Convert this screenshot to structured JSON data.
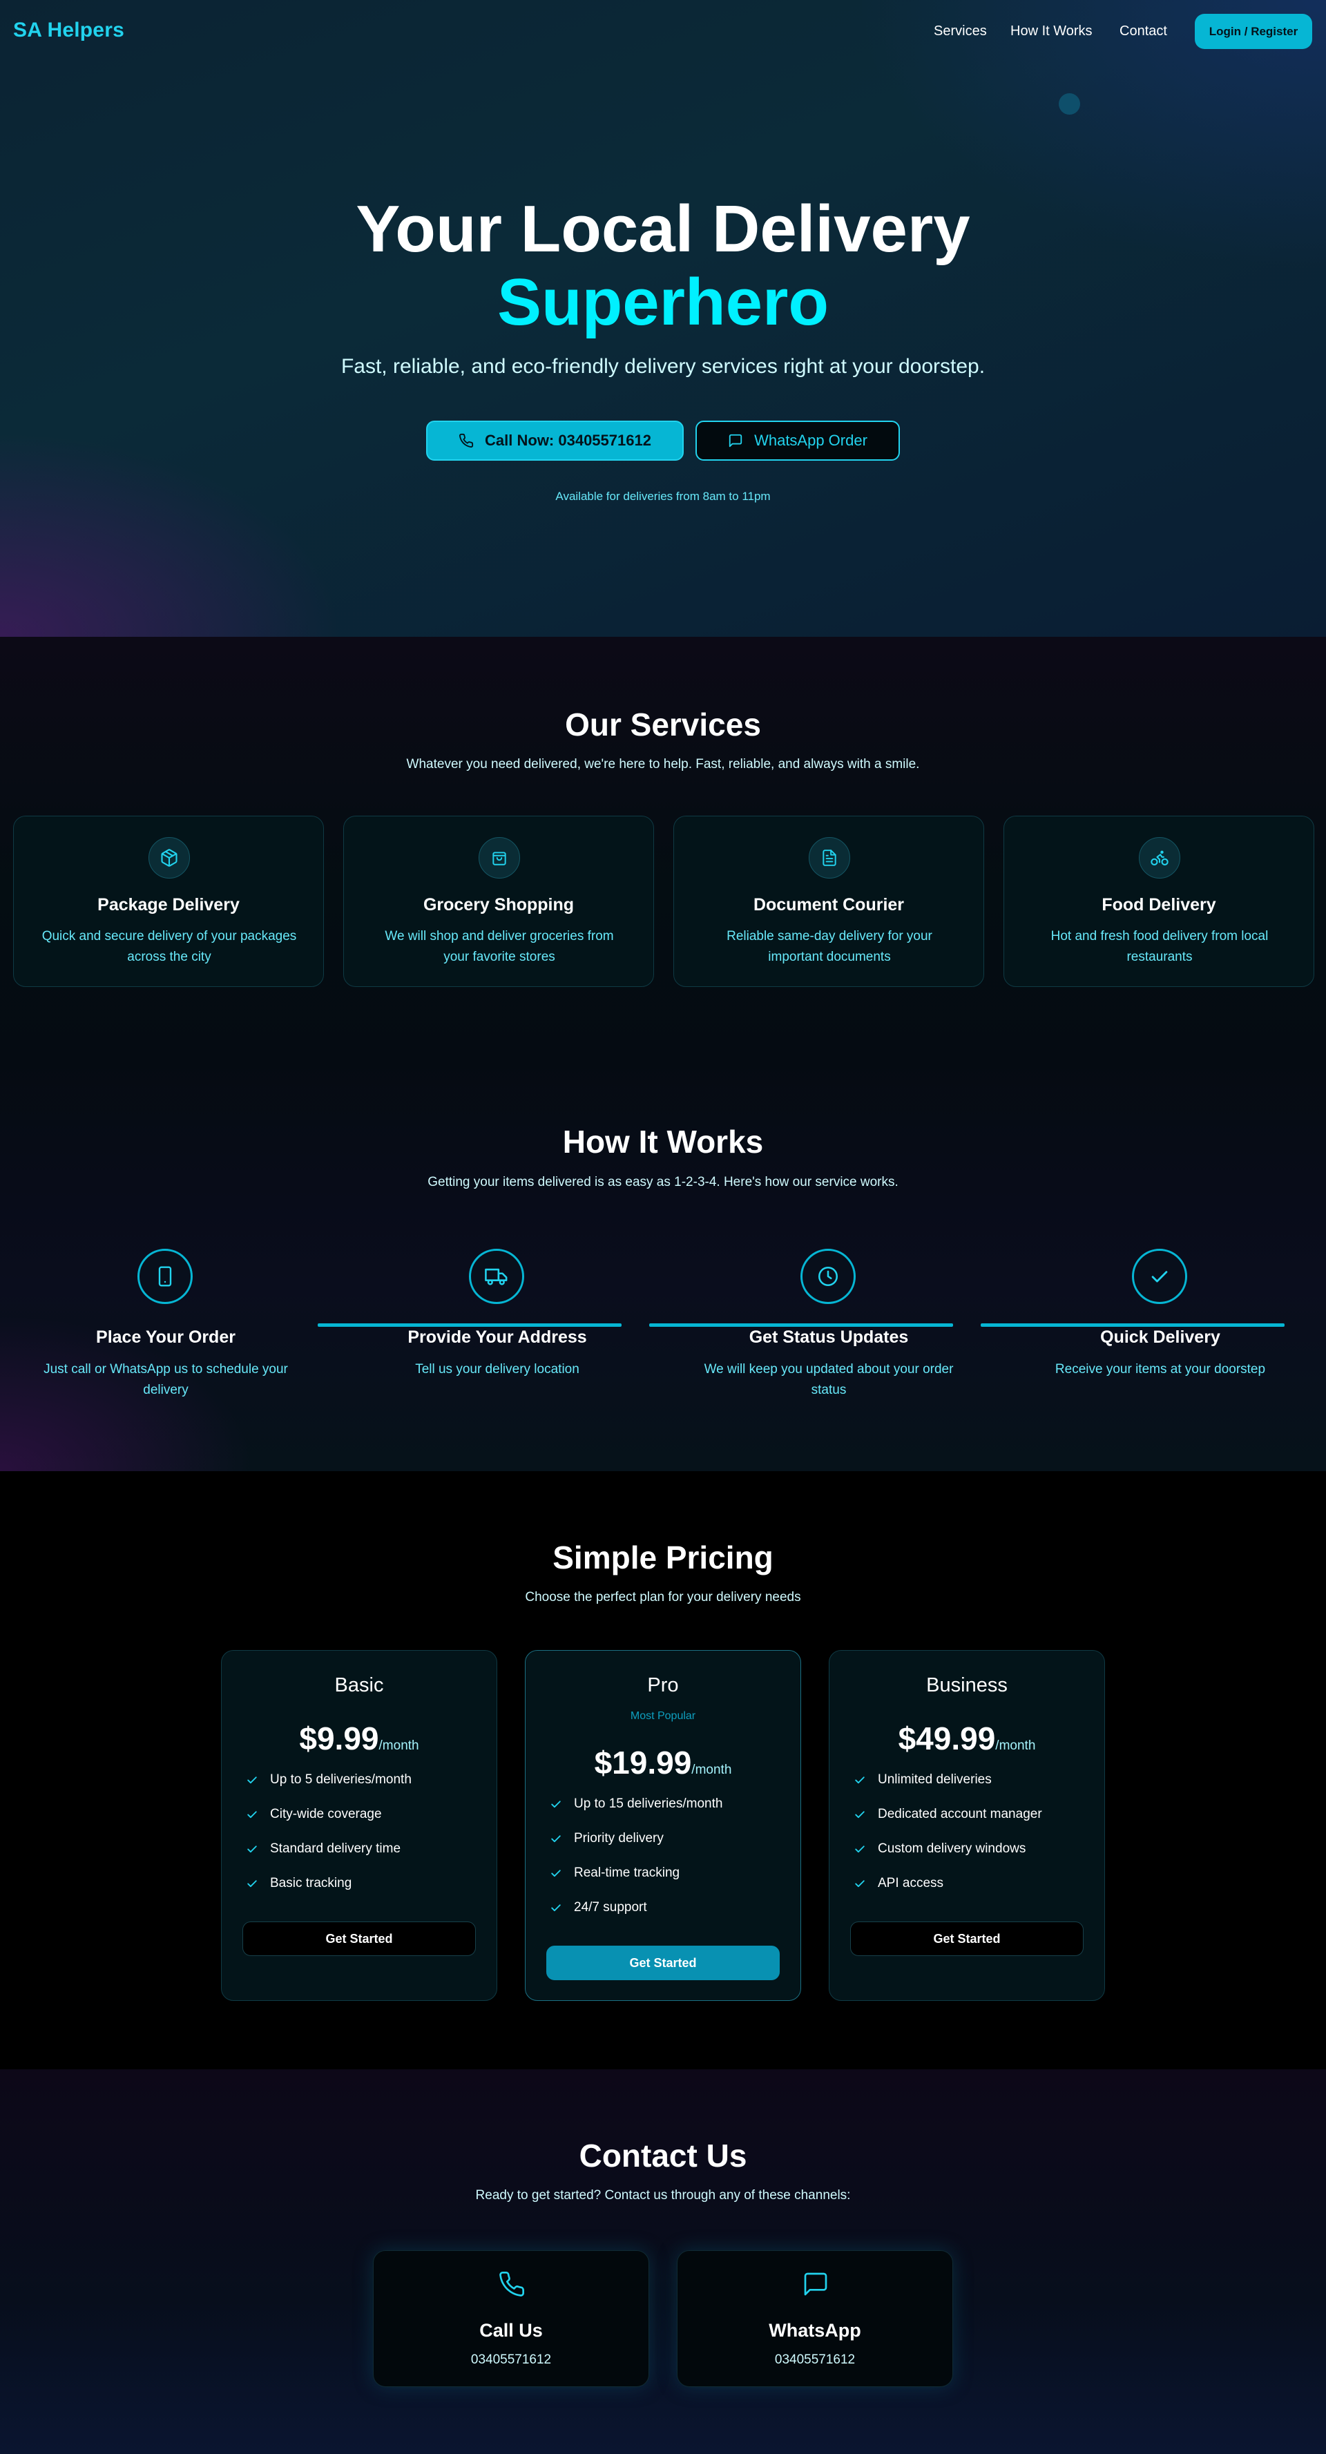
{
  "colors": {
    "accent": "#06b6d4",
    "accent_bright": "#00f0ff",
    "text_light": "#cffafe",
    "card_bg": "#031419"
  },
  "nav": {
    "logo": "SA Helpers",
    "links": [
      "Services",
      "How It Works",
      "Contact"
    ],
    "login_label": "Login / Register"
  },
  "hero": {
    "title_line1": "Your Local Delivery",
    "title_line2": "Superhero",
    "subtitle": "Fast, reliable, and eco-friendly delivery services right at your doorstep.",
    "call_button": {
      "label": "Call Now: 03405571612",
      "icon": "phone-icon"
    },
    "whatsapp_button": {
      "label": "WhatsApp Order",
      "icon": "message-icon"
    },
    "availability": "Available for deliveries from 8am to 11pm"
  },
  "services": {
    "title": "Our Services",
    "subtitle": "Whatever you need delivered, we're here to help. Fast, reliable, and always with a smile.",
    "items": [
      {
        "title": "Package Delivery",
        "line1": "Quick and secure delivery of your packages",
        "line2": "across the city",
        "icon": "package-icon"
      },
      {
        "title": "Grocery Shopping",
        "line1": "We will shop and deliver groceries from",
        "line2": "your favorite stores",
        "icon": "shopping-bag-icon"
      },
      {
        "title": "Document Courier",
        "line1": "Reliable same-day delivery for your",
        "line2": "important documents",
        "icon": "document-icon"
      },
      {
        "title": "Food Delivery",
        "line1": "Hot and fresh food delivery from local",
        "line2": "restaurants",
        "icon": "bike-icon"
      }
    ]
  },
  "how_it_works": {
    "title": "How It Works",
    "subtitle": "Getting your items delivered is as easy as 1-2-3-4. Here's how our service works.",
    "steps": [
      {
        "title": "Place Your Order",
        "line1": "Just call or WhatsApp us to schedule your",
        "line2": "delivery",
        "icon": "smartphone-icon"
      },
      {
        "title": "Provide Your Address",
        "line1": "Tell us your delivery location",
        "line2": "",
        "icon": "truck-icon"
      },
      {
        "title": "Get Status Updates",
        "line1": "We will keep you updated about your order",
        "line2": "status",
        "icon": "clock-icon"
      },
      {
        "title": "Quick Delivery",
        "line1": "Receive your items at your doorstep",
        "line2": "",
        "icon": "check-icon"
      }
    ]
  },
  "pricing": {
    "title": "Simple Pricing",
    "subtitle": "Choose the perfect plan for your delivery needs",
    "plans": [
      {
        "name": "Basic",
        "badge": "",
        "price": "$9.99",
        "period": "/month",
        "features": [
          "Up to 5 deliveries/month",
          "City-wide coverage",
          "Standard delivery time",
          "Basic tracking"
        ],
        "button": "Get Started"
      },
      {
        "name": "Pro",
        "badge": "Most Popular",
        "price": "$19.99",
        "period": "/month",
        "features": [
          "Up to 15 deliveries/month",
          "Priority delivery",
          "Real-time tracking",
          "24/7 support"
        ],
        "button": "Get Started"
      },
      {
        "name": "Business",
        "badge": "",
        "price": "$49.99",
        "period": "/month",
        "features": [
          "Unlimited deliveries",
          "Dedicated account manager",
          "Custom delivery windows",
          "API access"
        ],
        "button": "Get Started"
      }
    ]
  },
  "contact": {
    "title": "Contact Us",
    "subtitle": "Ready to get started? Contact us through any of these channels:",
    "channels": [
      {
        "title": "Call Us",
        "value": "03405571612",
        "icon": "phone-icon"
      },
      {
        "title": "WhatsApp",
        "value": "03405571612",
        "icon": "message-icon"
      }
    ]
  }
}
